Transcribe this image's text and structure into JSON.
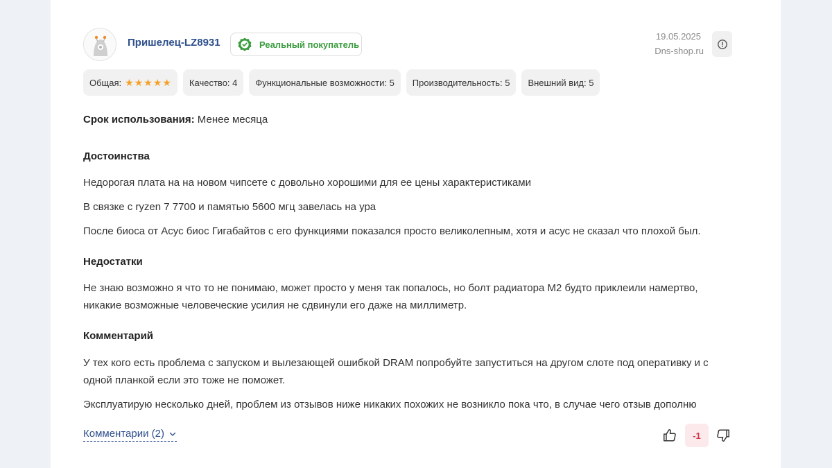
{
  "review": {
    "author": "Пришелец-LZ8931",
    "badge": "Реальный покупатель",
    "date": "19.05.2025",
    "source": "Dns-shop.ru",
    "ratings": {
      "overall_label": "Общая:",
      "overall_stars": 5,
      "items": [
        {
          "label": "Качество: 4"
        },
        {
          "label": "Функциональные возможности: 5"
        },
        {
          "label": "Производительность: 5"
        },
        {
          "label": "Внешний вид: 5"
        }
      ]
    },
    "usage": {
      "label": "Срок использования:",
      "value": " Менее месяца"
    },
    "pros": {
      "title": "Достоинства",
      "lines": [
        "Недорогая плата на на новом чипсете с довольно хорошими для ее цены характеристиками",
        "В связке с ryzen 7 7700 и памятью 5600 мгц завелась на ура",
        "После биоса от Асус биос Гигабайтов с его функциями показался просто великолепным, хотя и асус не сказал что плохой был."
      ]
    },
    "cons": {
      "title": "Недостатки",
      "text": "Не знаю возможно я что то не понимаю, может просто у меня так попалось, но болт радиатора М2 будто приклеили намертво, никакие возможные человеческие усилия не сдвинули его даже на миллиметр."
    },
    "comment": {
      "title": "Комментарий",
      "text1": "У тех кого есть проблема с запуском и вылезающей ошибкой DRAM попробуйте запуститься на другом слоте под оперативку и с одной планкой если это тоже не поможет.",
      "text2": "Эксплуатирую несколько дней, проблем из отзывов ниже никаких похожих не возникло пока что, в случае чего отзыв дополню"
    },
    "footer": {
      "comments_link": "Комментарии (2)",
      "score": "-1"
    }
  },
  "colors": {
    "link": "#2e4f8c",
    "badge_green": "#3a9c3e",
    "star": "#f6a023",
    "score_bg": "#fbe9ec",
    "score_text": "#d0364a"
  },
  "icons": [
    "avatar-icon",
    "verified-icon",
    "info-icon",
    "star-icon",
    "chevron-down-icon",
    "thumbs-up-icon",
    "thumbs-down-icon"
  ]
}
